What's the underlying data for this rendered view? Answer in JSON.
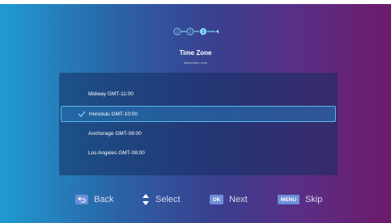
{
  "header": {
    "title": "Time Zone",
    "subtitle": "Select time zone"
  },
  "stepper": {
    "steps": [
      "1",
      "2",
      "3"
    ],
    "current_step": 3
  },
  "timezone_list": {
    "selected_index": 1,
    "items": [
      {
        "label": "Midway GMT-11:00"
      },
      {
        "label": "Honolulu GMT-10:00"
      },
      {
        "label": "Anchorage GMT-09:00"
      },
      {
        "label": "Los Angeles GMT-08:00"
      }
    ]
  },
  "footer": {
    "back": {
      "icon": "back-arrow-icon",
      "label": "Back"
    },
    "select": {
      "icon": "up-down-arrows-icon",
      "label": "Select"
    },
    "next": {
      "key": "OK",
      "label": "Next"
    },
    "skip": {
      "key": "MENU",
      "label": "Skip"
    }
  },
  "colors": {
    "selection_border": "#59b9e6",
    "key_badge": "#6f8fd8",
    "step_line": "#7fd6f3"
  }
}
